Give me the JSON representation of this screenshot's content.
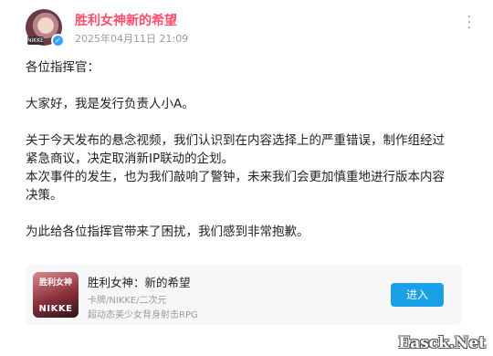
{
  "post": {
    "author": "胜利女神新的希望",
    "time": "2025年04月11日 21:09",
    "avatar_tag": "NIKKE",
    "paragraphs": [
      "各位指挥官：",
      "大家好，我是发行负责人小A。",
      "关于今天发布的悬念视频，我们认识到在内容选择上的严重错误，制作组经过紧急商议，决定取消新IP联动的企划。",
      "本次事件的发生，也为我们敲响了警钟，未来我们会更加慎重地进行版本内容决策。",
      "为此给各位指挥官带来了困扰，我们感到非常抱歉。"
    ]
  },
  "game_card": {
    "cover_title": "胜利女神",
    "cover_sub": "NIKKE",
    "title": "胜利女神：新的希望",
    "tags": "卡牌/NIKKE/二次元",
    "description": "超动态美少女背身射击RPG",
    "button_label": "进入"
  },
  "watermark": "Easck.Net",
  "colors": {
    "author": "#ff4d6a",
    "button": "#1aa0e6",
    "card_bg": "#f6f7f9"
  },
  "icons": {
    "more": "more-vertical-icon",
    "verify": "verified-badge-icon"
  }
}
